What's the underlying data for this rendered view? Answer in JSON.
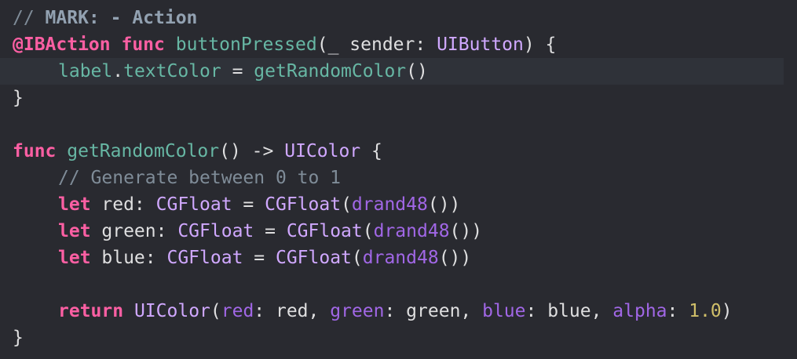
{
  "colors": {
    "background": "#292a30",
    "current_line": "#2f3239",
    "comment": "#7f8c98",
    "mark": "#92a1b1",
    "keyword": "#fc5fa3",
    "declaration": "#67b7a4",
    "type": "#d0a8ff",
    "parameter_label": "#a167e6",
    "number": "#d0bf69",
    "plain": "#dfdfe0"
  },
  "code_lines": [
    {
      "highlight": false,
      "indent": 0,
      "tokens": [
        {
          "text": "// ",
          "kind": "comment"
        },
        {
          "text": "MARK: - Action",
          "kind": "mark"
        }
      ]
    },
    {
      "highlight": false,
      "indent": 0,
      "tokens": [
        {
          "text": "@IBAction",
          "kind": "keyword"
        },
        {
          "text": " ",
          "kind": "plain"
        },
        {
          "text": "func",
          "kind": "keyword"
        },
        {
          "text": " ",
          "kind": "plain"
        },
        {
          "text": "buttonPressed",
          "kind": "decl"
        },
        {
          "text": "(_ sender: ",
          "kind": "plain"
        },
        {
          "text": "UIButton",
          "kind": "type"
        },
        {
          "text": ") {",
          "kind": "plain"
        }
      ]
    },
    {
      "highlight": true,
      "indent": 2,
      "tokens": [
        {
          "text": "label",
          "kind": "ident"
        },
        {
          "text": ".",
          "kind": "plain"
        },
        {
          "text": "textColor",
          "kind": "ident"
        },
        {
          "text": " = ",
          "kind": "plain"
        },
        {
          "text": "getRandomColor",
          "kind": "ident"
        },
        {
          "text": "()",
          "kind": "plain"
        }
      ]
    },
    {
      "highlight": false,
      "indent": 0,
      "tokens": [
        {
          "text": "}",
          "kind": "plain"
        }
      ]
    },
    {
      "highlight": false,
      "indent": 0,
      "tokens": []
    },
    {
      "highlight": false,
      "indent": 0,
      "tokens": [
        {
          "text": "func",
          "kind": "keyword"
        },
        {
          "text": " ",
          "kind": "plain"
        },
        {
          "text": "getRandomColor",
          "kind": "decl"
        },
        {
          "text": "() -> ",
          "kind": "plain"
        },
        {
          "text": "UIColor",
          "kind": "type"
        },
        {
          "text": " {",
          "kind": "plain"
        }
      ]
    },
    {
      "highlight": false,
      "indent": 2,
      "tokens": [
        {
          "text": "// Generate between 0 to 1",
          "kind": "comment"
        }
      ]
    },
    {
      "highlight": false,
      "indent": 2,
      "tokens": [
        {
          "text": "let",
          "kind": "keyword"
        },
        {
          "text": " red: ",
          "kind": "plain"
        },
        {
          "text": "CGFloat",
          "kind": "type"
        },
        {
          "text": " = ",
          "kind": "plain"
        },
        {
          "text": "CGFloat",
          "kind": "type"
        },
        {
          "text": "(",
          "kind": "plain"
        },
        {
          "text": "drand48",
          "kind": "call"
        },
        {
          "text": "())",
          "kind": "plain"
        }
      ]
    },
    {
      "highlight": false,
      "indent": 2,
      "tokens": [
        {
          "text": "let",
          "kind": "keyword"
        },
        {
          "text": " green: ",
          "kind": "plain"
        },
        {
          "text": "CGFloat",
          "kind": "type"
        },
        {
          "text": " = ",
          "kind": "plain"
        },
        {
          "text": "CGFloat",
          "kind": "type"
        },
        {
          "text": "(",
          "kind": "plain"
        },
        {
          "text": "drand48",
          "kind": "call"
        },
        {
          "text": "())",
          "kind": "plain"
        }
      ]
    },
    {
      "highlight": false,
      "indent": 2,
      "tokens": [
        {
          "text": "let",
          "kind": "keyword"
        },
        {
          "text": " blue: ",
          "kind": "plain"
        },
        {
          "text": "CGFloat",
          "kind": "type"
        },
        {
          "text": " = ",
          "kind": "plain"
        },
        {
          "text": "CGFloat",
          "kind": "type"
        },
        {
          "text": "(",
          "kind": "plain"
        },
        {
          "text": "drand48",
          "kind": "call"
        },
        {
          "text": "())",
          "kind": "plain"
        }
      ]
    },
    {
      "highlight": false,
      "indent": 0,
      "tokens": []
    },
    {
      "highlight": false,
      "indent": 2,
      "tokens": [
        {
          "text": "return",
          "kind": "keyword"
        },
        {
          "text": " ",
          "kind": "plain"
        },
        {
          "text": "UIColor",
          "kind": "type"
        },
        {
          "text": "(",
          "kind": "plain"
        },
        {
          "text": "red",
          "kind": "param"
        },
        {
          "text": ": red, ",
          "kind": "plain"
        },
        {
          "text": "green",
          "kind": "param"
        },
        {
          "text": ": green, ",
          "kind": "plain"
        },
        {
          "text": "blue",
          "kind": "param"
        },
        {
          "text": ": blue, ",
          "kind": "plain"
        },
        {
          "text": "alpha",
          "kind": "param"
        },
        {
          "text": ": ",
          "kind": "plain"
        },
        {
          "text": "1.0",
          "kind": "number"
        },
        {
          "text": ")",
          "kind": "plain"
        }
      ]
    },
    {
      "highlight": false,
      "indent": 0,
      "tokens": [
        {
          "text": "}",
          "kind": "plain"
        }
      ]
    }
  ]
}
